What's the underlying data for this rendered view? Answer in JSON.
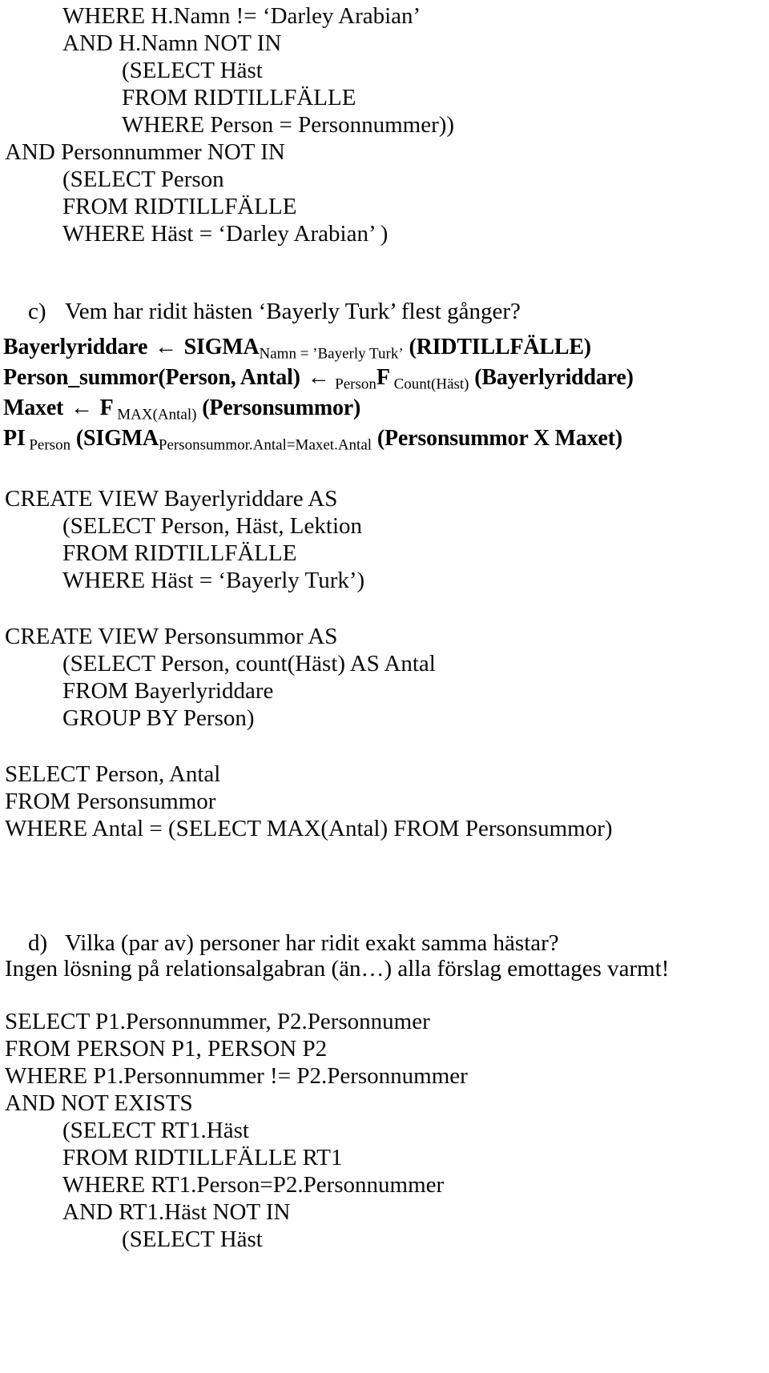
{
  "document": {
    "type": "scanned-exam-solution-page",
    "language": "sv",
    "text_color": "#0a0a0a",
    "background_color": "#ffffff"
  },
  "sql_block_b_tail": {
    "lines": [
      {
        "indent": 1,
        "text": "WHERE H.Namn != ‘Darley Arabian’"
      },
      {
        "indent": 1,
        "text": "AND H.Namn NOT IN"
      },
      {
        "indent": 2,
        "text": "(SELECT Häst"
      },
      {
        "indent": 2,
        "text": "FROM RIDTILLFÄLLE"
      },
      {
        "indent": 2,
        "text": "WHERE Person = Personnummer))"
      },
      {
        "indent": 0,
        "text": "AND Personnummer NOT IN"
      },
      {
        "indent": 1,
        "text": "(SELECT Person"
      },
      {
        "indent": 1,
        "text": "FROM RIDTILLFÄLLE"
      },
      {
        "indent": 1,
        "text": "WHERE Häst = ‘Darley Arabian’ )"
      }
    ]
  },
  "question_c": {
    "marker": "c)",
    "text": "Vem har ridit hästen ‘Bayerly Turk’ flest gånger?"
  },
  "relational_algebra": {
    "lines": [
      {
        "id": "ra-bayerlyriddare",
        "segments": [
          {
            "kind": "main",
            "text": "Bayerlyriddare "
          },
          {
            "kind": "arrow",
            "text": "←"
          },
          {
            "kind": "main",
            "text": " SIGMA"
          },
          {
            "kind": "sub",
            "text": "Namn = ’Bayerly Turk’"
          },
          {
            "kind": "main",
            "text": " (RIDTILLFÄLLE)"
          }
        ]
      },
      {
        "id": "ra-person-summor",
        "segments": [
          {
            "kind": "main",
            "text": "Person_summor(Person, Antal) "
          },
          {
            "kind": "arrow",
            "text": "←"
          },
          {
            "kind": "sub",
            "text": " Person"
          },
          {
            "kind": "main",
            "text": "F"
          },
          {
            "kind": "sub",
            "text": " Count(Häst)"
          },
          {
            "kind": "main",
            "text": " (Bayerlyriddare)"
          }
        ]
      },
      {
        "id": "ra-maxet",
        "segments": [
          {
            "kind": "main",
            "text": "Maxet "
          },
          {
            "kind": "arrow",
            "text": "←"
          },
          {
            "kind": "main",
            "text": " F"
          },
          {
            "kind": "sub",
            "text": " MAX(Antal)"
          },
          {
            "kind": "main",
            "text": " (Personsummor)"
          }
        ]
      },
      {
        "id": "ra-pi",
        "segments": [
          {
            "kind": "main",
            "text": "PI"
          },
          {
            "kind": "sub",
            "text": " Person"
          },
          {
            "kind": "main",
            "text": " (SIGMA"
          },
          {
            "kind": "sub",
            "text": "Personsummor.Antal=Maxet.Antal"
          },
          {
            "kind": "main",
            "text": " (Personsummor X Maxet)"
          }
        ]
      }
    ]
  },
  "sql_view_bayerlyriddare": {
    "lines": [
      {
        "indent": 0,
        "text": "CREATE VIEW Bayerlyriddare AS"
      },
      {
        "indent": 1,
        "text": "(SELECT Person, Häst, Lektion"
      },
      {
        "indent": 1,
        "text": "FROM RIDTILLFÄLLE"
      },
      {
        "indent": 1,
        "text": "WHERE Häst = ‘Bayerly Turk’)"
      }
    ]
  },
  "sql_view_personsummor": {
    "lines": [
      {
        "indent": 0,
        "text": "CREATE VIEW Personsummor AS"
      },
      {
        "indent": 1,
        "text": "(SELECT Person, count(Häst) AS Antal"
      },
      {
        "indent": 1,
        "text": "FROM Bayerlyriddare"
      },
      {
        "indent": 1,
        "text": "GROUP BY Person)"
      }
    ]
  },
  "sql_select_personsummor": {
    "lines": [
      {
        "indent": 0,
        "text": "SELECT Person, Antal"
      },
      {
        "indent": 0,
        "text": "FROM Personsummor"
      },
      {
        "indent": 0,
        "text": "WHERE Antal = (SELECT MAX(Antal) FROM Personsummor)"
      }
    ]
  },
  "question_d": {
    "marker": "d)",
    "text": "Vilka (par av) personer har ridit exakt samma hästar?"
  },
  "note_d": {
    "text": "Ingen lösning på relationsalgabran (än…) alla förslag emottages varmt!"
  },
  "sql_block_d": {
    "lines": [
      {
        "indent": 0,
        "text": "SELECT P1.Personnummer, P2.Personnumer"
      },
      {
        "indent": 0,
        "text": "FROM PERSON P1, PERSON P2"
      },
      {
        "indent": 0,
        "text": "WHERE P1.Personnummer != P2.Personnummer"
      },
      {
        "indent": 0,
        "text": "AND NOT EXISTS"
      },
      {
        "indent": 1,
        "text": "(SELECT RT1.Häst"
      },
      {
        "indent": 1,
        "text": "FROM RIDTILLFÄLLE RT1"
      },
      {
        "indent": 1,
        "text": "WHERE RT1.Person=P2.Personnummer"
      },
      {
        "indent": 1,
        "text": "AND RT1.Häst NOT IN"
      },
      {
        "indent": 2,
        "text": "(SELECT Häst"
      }
    ]
  }
}
